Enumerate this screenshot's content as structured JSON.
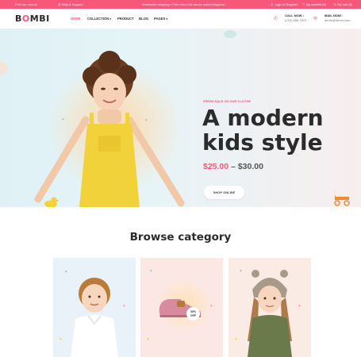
{
  "topbar": {
    "search_placeholder": "Find our search",
    "help": "Help & Support",
    "shipping": "Worldwide shipping • Free return for above united kingdom !",
    "login": "Login & Register",
    "wishlist": "My wishlist (0)",
    "cart": "My cart (0)"
  },
  "header": {
    "logo_prefix": "B",
    "logo_o": "O",
    "logo_suffix": "MBI",
    "nav": [
      "HOME",
      "COLLECTION",
      "PRODUCT",
      "BLOG",
      "PAGES"
    ],
    "call_label": "CALL NOW :",
    "call_value": "(+22) 656 7870",
    "mail_label": "MAIL NOW :",
    "mail_value": "demo@demo.com"
  },
  "hero": {
    "eyebrow": "FRESH SALE ON OUR CLOTHE",
    "title_line1": "A modern",
    "title_line2": "kids style",
    "price_new": "$25.00",
    "price_sep": "–",
    "price_old": "$30.00",
    "button": "SHOP ONLINE"
  },
  "categories": {
    "title": "Browse category",
    "badge_line1": "30%",
    "badge_line2": "OFF"
  },
  "colors": {
    "accent": "#f6577a",
    "hero_bg": "#e4f3f6",
    "card1_bg": "#e8f1fa",
    "card2_bg": "#fbe7e6",
    "card3_bg": "#fbece7"
  },
  "icons": [
    "search-icon",
    "help-icon",
    "user-icon",
    "heart-icon",
    "cart-icon",
    "phone-icon",
    "mail-icon",
    "chevron-down-icon"
  ]
}
